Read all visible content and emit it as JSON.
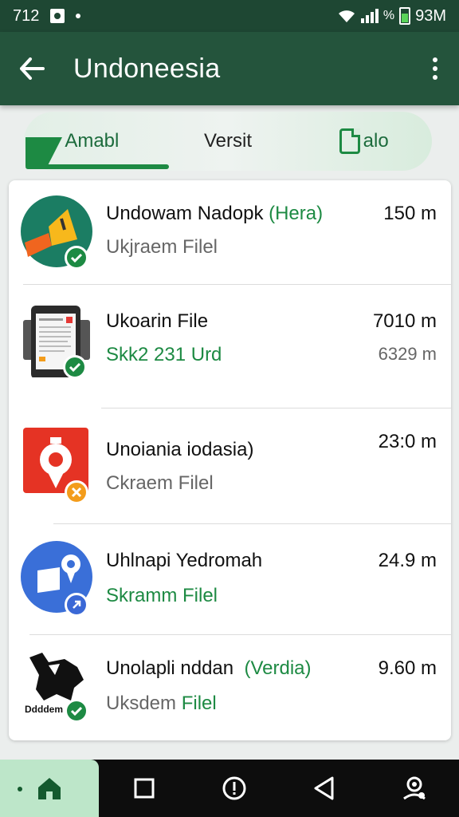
{
  "status_bar": {
    "time": "712",
    "battery_text": "93M",
    "percent_text": "%"
  },
  "app_bar": {
    "title": "Undoneesia"
  },
  "tabs": [
    {
      "label": "Amabl",
      "active": true
    },
    {
      "label": "Versit",
      "active": false
    },
    {
      "label": "alo",
      "active": false
    }
  ],
  "items": [
    {
      "title": "Undowam Nadopk",
      "title_accent": "(Hera)",
      "subtitle": "Ukjraem Filel",
      "size": "150 m",
      "icon": "megaphone-icon",
      "badge": "check-icon",
      "badge_color": "#1d8a43"
    },
    {
      "title": "Ukoarin File",
      "title_accent": "",
      "subtitle": "Skk2 231 Urd",
      "size": "7010 m",
      "size_secondary": "6329 m",
      "icon": "phone-document-icon",
      "badge": "check-icon",
      "badge_color": "#1d8a43"
    },
    {
      "title": "Unoiania iodasia)",
      "title_accent": "",
      "subtitle": "Ckraem Filel",
      "size": "23:0 m",
      "icon": "map-pin-icon",
      "badge": "tools-icon",
      "badge_color": "#f39c1b"
    },
    {
      "title": "Uhlnapi Yedromah",
      "title_accent": "",
      "subtitle": "Skramm Filel",
      "size": "24.9 m",
      "icon": "location-tag-icon",
      "badge": "arrow-icon",
      "badge_color": "#3a68d6"
    },
    {
      "title": "Unolapli nddan",
      "title_accent": "(Verdia)",
      "subtitle_prefix": "Uksdem",
      "subtitle_suffix": "Filel",
      "size": "9.60 m",
      "icon": "map-island-icon",
      "icon_caption": "Ddddem",
      "badge": "check-icon",
      "badge_color": "#1d8a43"
    }
  ],
  "nav": [
    {
      "name": "home-icon",
      "active": true
    },
    {
      "name": "square-icon",
      "active": false
    },
    {
      "name": "alert-icon",
      "active": false
    },
    {
      "name": "back-triangle-icon",
      "active": false
    },
    {
      "name": "profile-icon",
      "active": false
    }
  ]
}
